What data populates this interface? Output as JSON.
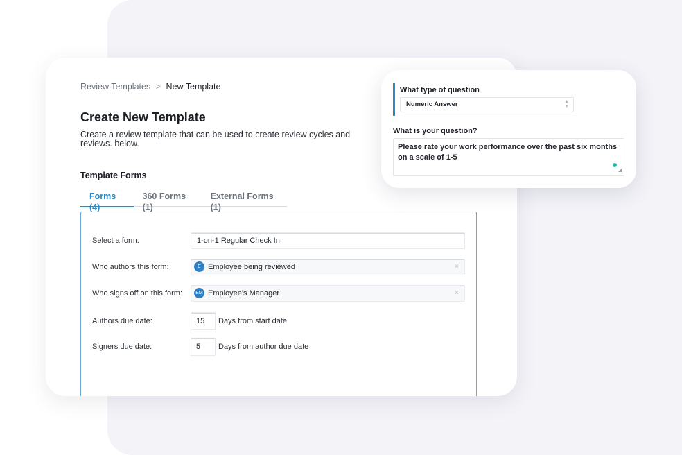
{
  "breadcrumb": {
    "parent": "Review Templates",
    "separator": ">",
    "current": "New Template"
  },
  "page": {
    "title": "Create New Template",
    "description": "Create a review template that can be used to create review cycles and reviews. below."
  },
  "template_forms": {
    "section_title": "Template Forms",
    "tabs": [
      {
        "label": "Forms (4)",
        "active": true
      },
      {
        "label": "360 Forms (1)",
        "active": false
      },
      {
        "label": "External Forms (1)",
        "active": false
      }
    ]
  },
  "form": {
    "select_label": "Select a form:",
    "select_value": "1-on-1 Regular Check In",
    "authors_label": "Who authors this form:",
    "authors_avatar": "E",
    "authors_value": "Employee being reviewed",
    "signers_label": "Who signs off on this form:",
    "signers_avatar": "EM",
    "signers_value": "Employee's Manager",
    "clear_glyph": "×",
    "authors_due_label": "Authors due date:",
    "authors_due_value": "15",
    "authors_due_suffix": "Days from start date",
    "signers_due_label": "Signers due date:",
    "signers_due_value": "5",
    "signers_due_suffix": "Days from author due date"
  },
  "question": {
    "type_label": "What type of question",
    "type_value": "Numeric Answer",
    "question_label": "What is your question?",
    "question_value": "Please rate your work performance over the past six months on a scale of 1-5"
  },
  "colors": {
    "accent": "#2e87c0",
    "avatar": "#2f7fc4",
    "status_dot": "#2bb7a8",
    "background_panel": "#f3f3f8"
  }
}
